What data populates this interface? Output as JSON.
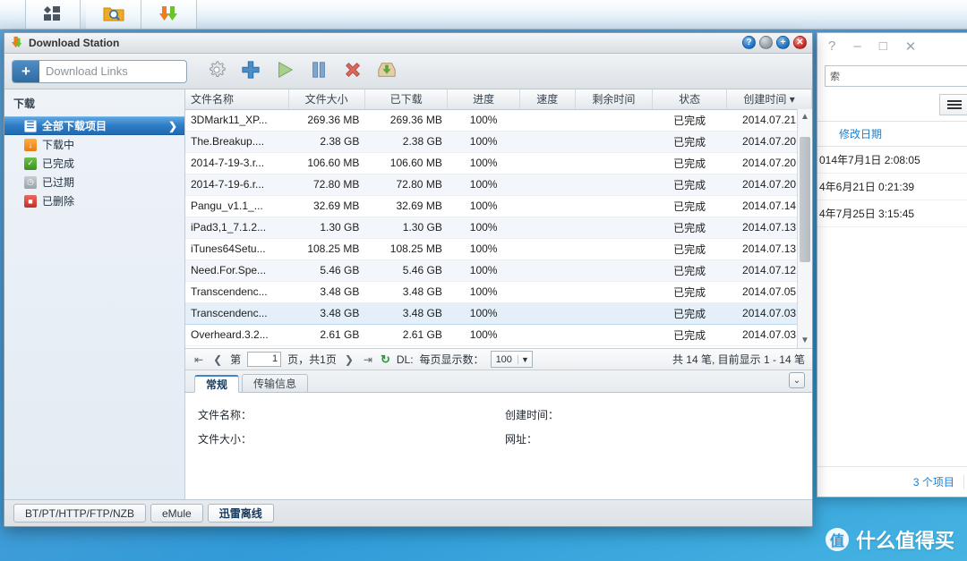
{
  "taskbar": {
    "icons": [
      {
        "name": "apps-grid-icon",
        "glyph": "apps"
      },
      {
        "name": "file-search-folder-icon",
        "glyph": "folder-search"
      },
      {
        "name": "download-arrow-icon",
        "glyph": "download"
      }
    ]
  },
  "background_window": {
    "titlebar_buttons": [
      "?",
      "–",
      "□",
      "✕"
    ],
    "search_value": "索",
    "view_button_icon": "list-view-icon",
    "view_dropdown_icon": "chevron-down-icon",
    "column_header": "修改日期",
    "rows": [
      "014年7月1日 2:08:05",
      "4年6月21日 0:21:39",
      "4年7月25日 3:15:45"
    ],
    "status_text": "3 个项目",
    "refresh_icon": "refresh-icon"
  },
  "download_station": {
    "title": "Download Station",
    "title_icon": "download-station-icon",
    "window_buttons": [
      {
        "name": "help-button",
        "glyph": "?"
      },
      {
        "name": "minimize-button",
        "glyph": ""
      },
      {
        "name": "maximize-button",
        "glyph": "+"
      },
      {
        "name": "close-button",
        "glyph": "✕"
      }
    ],
    "toolbar": {
      "download_links_placeholder": "Download Links",
      "add_icon": "plus-icon",
      "buttons": [
        {
          "name": "settings-button",
          "icon": "gear-icon"
        },
        {
          "name": "add-task-button",
          "icon": "plus-icon"
        },
        {
          "name": "start-button",
          "icon": "play-icon"
        },
        {
          "name": "pause-button",
          "icon": "pause-icon"
        },
        {
          "name": "delete-button",
          "icon": "close-x-icon"
        },
        {
          "name": "download-to-button",
          "icon": "download-box-icon"
        }
      ]
    },
    "sidebar": {
      "header": "下载",
      "items": [
        {
          "label": "全部下载项目",
          "icon": "list-all-icon",
          "active": true
        },
        {
          "label": "下载中",
          "icon": "downloading-icon",
          "active": false
        },
        {
          "label": "已完成",
          "icon": "completed-check-icon",
          "active": false
        },
        {
          "label": "已过期",
          "icon": "expired-clock-icon",
          "active": false
        },
        {
          "label": "已删除",
          "icon": "deleted-trash-icon",
          "active": false
        }
      ]
    },
    "table": {
      "columns": [
        "文件名称",
        "文件大小",
        "已下载",
        "进度",
        "速度",
        "剩余时间",
        "状态",
        "创建时间"
      ],
      "sort_column": "创建时间",
      "sort_icon": "sort-desc-arrow-icon",
      "rows": [
        {
          "name": "3DMark11_XP...",
          "size": "269.36 MB",
          "downloaded": "269.36 MB",
          "progress": "100%",
          "speed": "",
          "remaining": "",
          "status": "已完成",
          "created": "2014.07.21"
        },
        {
          "name": "The.Breakup....",
          "size": "2.38 GB",
          "downloaded": "2.38 GB",
          "progress": "100%",
          "speed": "",
          "remaining": "",
          "status": "已完成",
          "created": "2014.07.20"
        },
        {
          "name": "2014-7-19-3.r...",
          "size": "106.60 MB",
          "downloaded": "106.60 MB",
          "progress": "100%",
          "speed": "",
          "remaining": "",
          "status": "已完成",
          "created": "2014.07.20"
        },
        {
          "name": "2014-7-19-6.r...",
          "size": "72.80 MB",
          "downloaded": "72.80 MB",
          "progress": "100%",
          "speed": "",
          "remaining": "",
          "status": "已完成",
          "created": "2014.07.20"
        },
        {
          "name": "Pangu_v1.1_...",
          "size": "32.69 MB",
          "downloaded": "32.69 MB",
          "progress": "100%",
          "speed": "",
          "remaining": "",
          "status": "已完成",
          "created": "2014.07.14"
        },
        {
          "name": "iPad3,1_7.1.2...",
          "size": "1.30 GB",
          "downloaded": "1.30 GB",
          "progress": "100%",
          "speed": "",
          "remaining": "",
          "status": "已完成",
          "created": "2014.07.13"
        },
        {
          "name": "iTunes64Setu...",
          "size": "108.25 MB",
          "downloaded": "108.25 MB",
          "progress": "100%",
          "speed": "",
          "remaining": "",
          "status": "已完成",
          "created": "2014.07.13"
        },
        {
          "name": "Need.For.Spe...",
          "size": "5.46 GB",
          "downloaded": "5.46 GB",
          "progress": "100%",
          "speed": "",
          "remaining": "",
          "status": "已完成",
          "created": "2014.07.12"
        },
        {
          "name": "Transcendenc...",
          "size": "3.48 GB",
          "downloaded": "3.48 GB",
          "progress": "100%",
          "speed": "",
          "remaining": "",
          "status": "已完成",
          "created": "2014.07.05"
        },
        {
          "name": "Transcendenc...",
          "size": "3.48 GB",
          "downloaded": "3.48 GB",
          "progress": "100%",
          "speed": "",
          "remaining": "",
          "status": "已完成",
          "created": "2014.07.03",
          "selected": true
        },
        {
          "name": "Overheard.3.2...",
          "size": "2.61 GB",
          "downloaded": "2.61 GB",
          "progress": "100%",
          "speed": "",
          "remaining": "",
          "status": "已完成",
          "created": "2014.07.03"
        }
      ]
    },
    "pager": {
      "first_icon": "first-page-icon",
      "prev_icon": "prev-page-icon",
      "next_icon": "next-page-icon",
      "last_icon": "last-page-icon",
      "page_prefix": "第",
      "page_value": "1",
      "page_suffix": "页，共1页",
      "refresh_icon": "refresh-icon",
      "dl_label": "DL:",
      "per_page_label": "每页显示数：",
      "per_page_value": "100",
      "summary": "共 14 笔, 目前显示 1 - 14 笔"
    },
    "detail": {
      "tabs": [
        {
          "label": "常规",
          "active": true
        },
        {
          "label": "传输信息",
          "active": false
        }
      ],
      "collapse_icon": "chevron-double-down-icon",
      "fields": [
        {
          "label": "文件名称：",
          "value": ""
        },
        {
          "label": "创建时间：",
          "value": ""
        },
        {
          "label": "文件大小：",
          "value": ""
        },
        {
          "label": "网址：",
          "value": ""
        }
      ]
    },
    "footer_tabs": [
      {
        "label": "BT/PT/HTTP/FTP/NZB",
        "active": false
      },
      {
        "label": "eMule",
        "active": false
      },
      {
        "label": "迅雷离线",
        "active": true
      }
    ]
  },
  "watermark": {
    "badge": "值",
    "text": "什么值得买"
  },
  "colors": {
    "accent_blue": "#2e7cc4",
    "desktop_blue": "#3c8fce",
    "link_blue": "#1a7fd4",
    "selected_row": "#e5eff9"
  }
}
